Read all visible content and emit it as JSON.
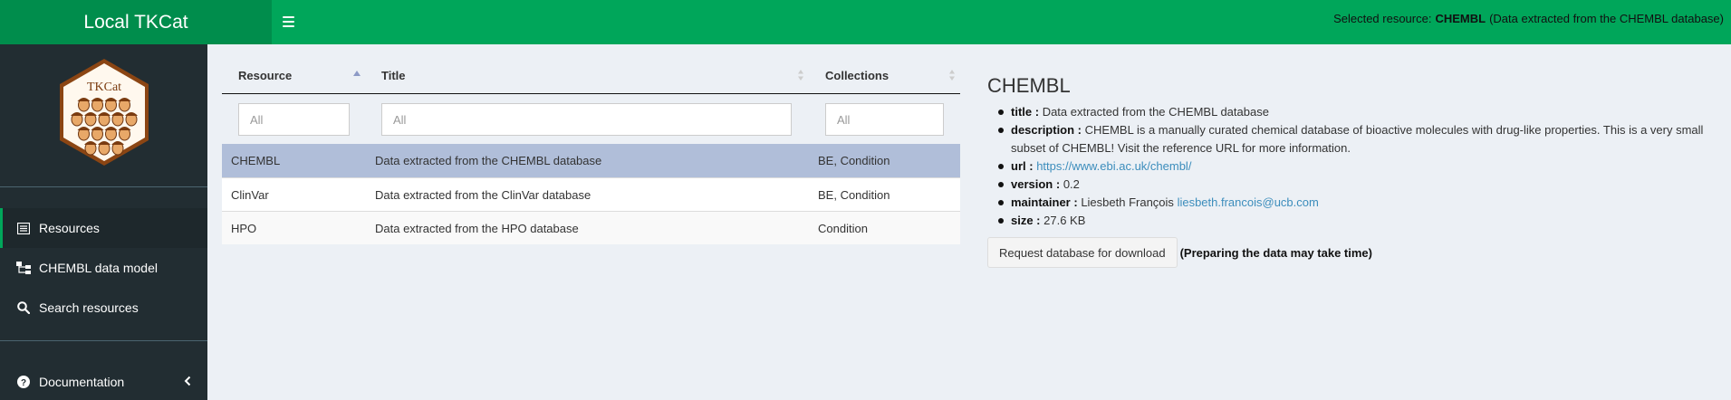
{
  "header": {
    "app_title": "Local TKCat",
    "selected_prefix": "Selected resource:",
    "selected_name": "CHEMBL",
    "selected_title": "(Data extracted from the CHEMBL database)"
  },
  "sidebar": {
    "logo_text": "TKCat",
    "items": [
      {
        "label": "Resources",
        "icon": "list-icon"
      },
      {
        "label": "CHEMBL data model",
        "icon": "sitemap-icon"
      },
      {
        "label": "Search resources",
        "icon": "search-icon"
      },
      {
        "label": "Documentation",
        "icon": "question-circle-icon"
      }
    ]
  },
  "table": {
    "columns": [
      "Resource",
      "Title",
      "Collections"
    ],
    "filter_placeholders": [
      "All",
      "All",
      "All"
    ],
    "rows": [
      {
        "resource": "CHEMBL",
        "title": "Data extracted from the CHEMBL database",
        "collections": "BE, Condition"
      },
      {
        "resource": "ClinVar",
        "title": "Data extracted from the ClinVar database",
        "collections": "BE, Condition"
      },
      {
        "resource": "HPO",
        "title": "Data extracted from the HPO database",
        "collections": "Condition"
      }
    ]
  },
  "detail": {
    "heading": "CHEMBL",
    "fields": {
      "title_label": "title :",
      "title_value": "Data extracted from the CHEMBL database",
      "description_label": "description :",
      "description_value": "CHEMBL is a manually curated chemical database of bioactive molecules with drug-like properties. This is a very small subset of CHEMBL! Visit the reference URL for more information.",
      "url_label": "url :",
      "url_value": "https://www.ebi.ac.uk/chembl/",
      "version_label": "version :",
      "version_value": "0.2",
      "maintainer_label": "maintainer :",
      "maintainer_name": "Liesbeth François",
      "maintainer_email": "liesbeth.francois@ucb.com",
      "size_label": "size :",
      "size_value": "27.6 KB"
    },
    "download_button": "Request database for download",
    "download_note": "(Preparing the data may take time)"
  },
  "colors": {
    "header_green": "#00a65a",
    "logo_green": "#008d4c",
    "sidebar_dark": "#222d32",
    "selected_row": "#b0bed9",
    "link": "#3c8dbc"
  }
}
